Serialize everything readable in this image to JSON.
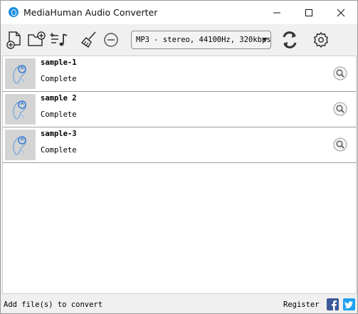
{
  "window": {
    "title": "MediaHuman Audio Converter",
    "controls": {
      "minimize": "minimize-icon",
      "maximize": "maximize-icon",
      "close": "close-icon"
    }
  },
  "toolbar": {
    "icons": [
      "add-file-icon",
      "add-folder-icon",
      "add-playlist-icon",
      "clear-list-icon",
      "remove-icon",
      "convert-icon",
      "settings-icon"
    ],
    "format": "MP3 - stereo, 44100Hz, 320kbps"
  },
  "files": [
    {
      "name": "sample-1",
      "status": "Complete"
    },
    {
      "name": "sample 2",
      "status": "Complete"
    },
    {
      "name": "sample-3",
      "status": "Complete"
    }
  ],
  "statusbar": {
    "text": "Add file(s) to convert",
    "register": "Register",
    "social": [
      "facebook-icon",
      "twitter-icon"
    ]
  },
  "colors": {
    "accent": "#1b8fe0",
    "facebook": "#3b5998",
    "twitter": "#1da1f2",
    "thumb_bg": "#d4d4d4"
  }
}
